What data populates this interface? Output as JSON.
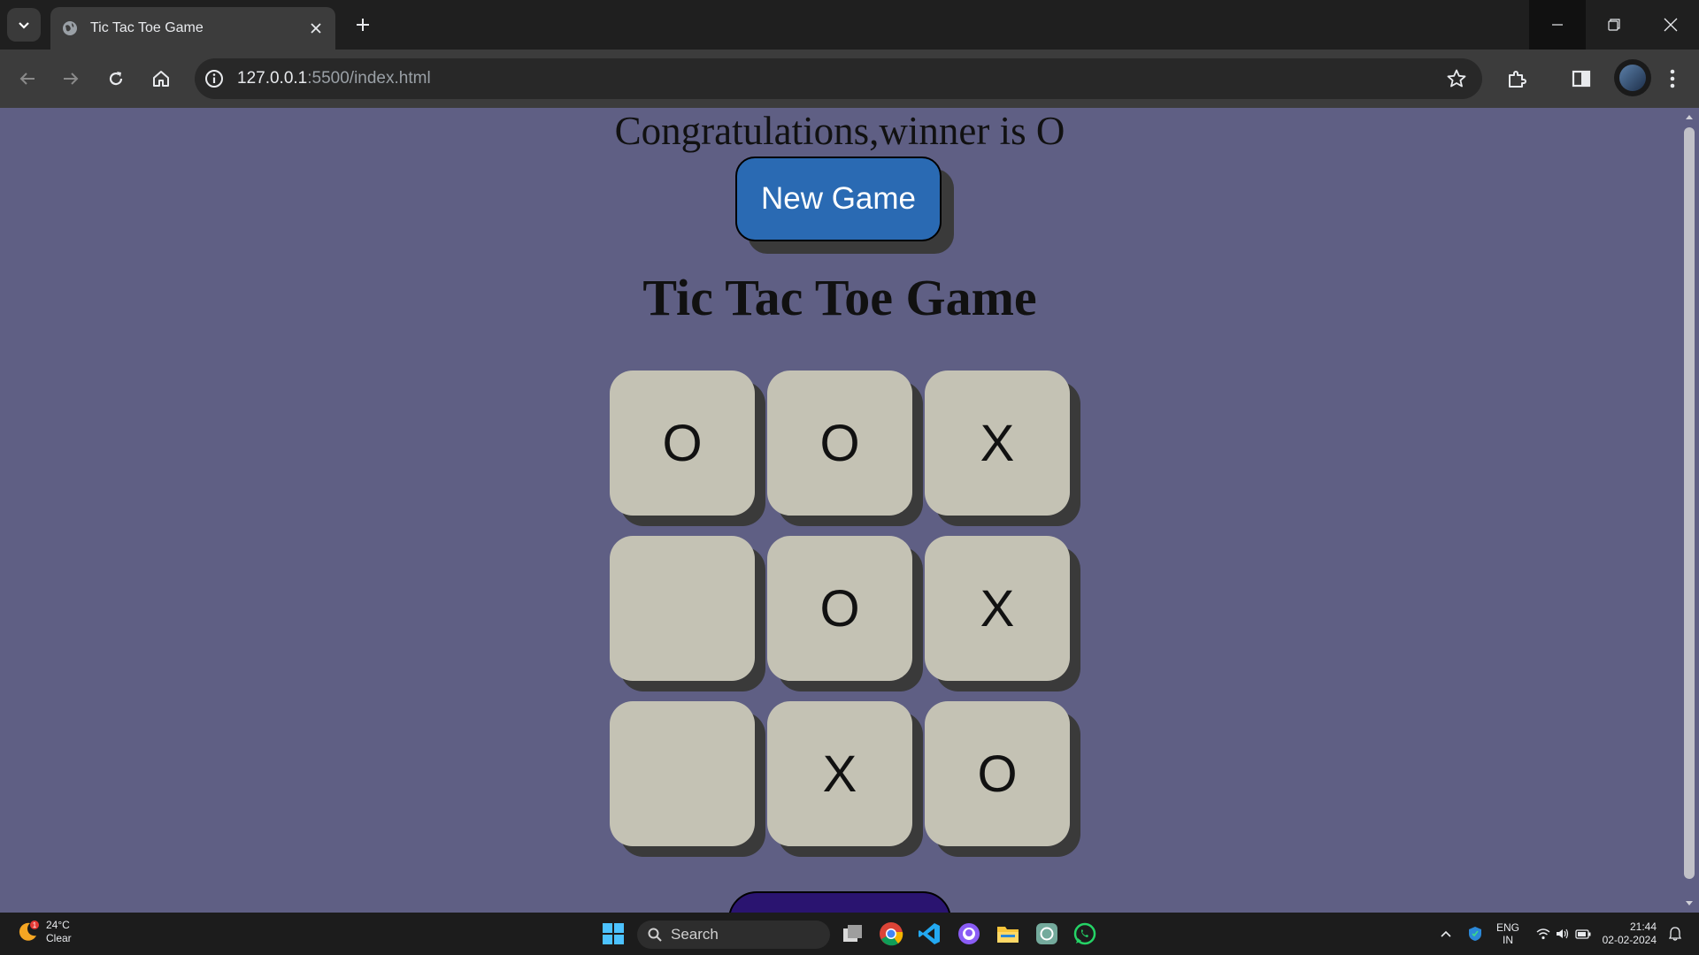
{
  "browser": {
    "tab_title": "Tic Tac Toe Game",
    "url_host": "127.0.0.1",
    "url_path": ":5500/index.html"
  },
  "page": {
    "winner_message": "Congratulations,winner is O",
    "new_game_label": "New Game",
    "title": "Tic Tac Toe Game",
    "board": [
      "O",
      "O",
      "X",
      "",
      "O",
      "X",
      "",
      "X",
      "O"
    ]
  },
  "taskbar": {
    "temperature": "24°C",
    "weather": "Clear",
    "weather_badge": "1",
    "search_label": "Search",
    "lang_top": "ENG",
    "lang_bottom": "IN",
    "time": "21:44",
    "date": "02-02-2024"
  },
  "colors": {
    "page_bg": "#5f5f84",
    "cell_bg": "#c4c2b4",
    "new_game_bg": "#2a6ab3",
    "cell_shadow": "#3a3a3a"
  }
}
